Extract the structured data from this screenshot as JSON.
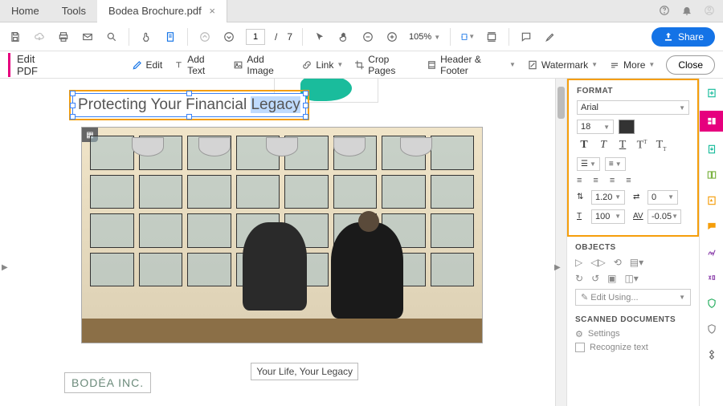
{
  "tabs": {
    "home": "Home",
    "tools": "Tools",
    "file": "Bodea Brochure.pdf"
  },
  "topright": {
    "help": "?",
    "bell": "🔔",
    "user": "◔"
  },
  "toolbar": {
    "page_current": "1",
    "page_sep": "/",
    "page_total": "7",
    "zoom": "105%",
    "share": "Share"
  },
  "editbar": {
    "title": "Edit PDF",
    "edit": "Edit",
    "add_text": "Add Text",
    "add_image": "Add Image",
    "link": "Link",
    "crop": "Crop Pages",
    "header_footer": "Header & Footer",
    "watermark": "Watermark",
    "more": "More",
    "close": "Close"
  },
  "canvas": {
    "headline_pre": "Protecting Your Financial ",
    "headline_sel": "Legacy",
    "bodea": "BODÉA INC.",
    "tagline": "Your Life, Your Legacy"
  },
  "format": {
    "title": "FORMAT",
    "font": "Arial",
    "size": "18",
    "line_height": "1.20",
    "indent": "0",
    "scale": "100",
    "tracking": "-0.05",
    "objects_title": "OBJECTS",
    "edit_using": "Edit Using...",
    "scanned_title": "SCANNED DOCUMENTS",
    "settings": "Settings",
    "recognize": "Recognize text"
  }
}
